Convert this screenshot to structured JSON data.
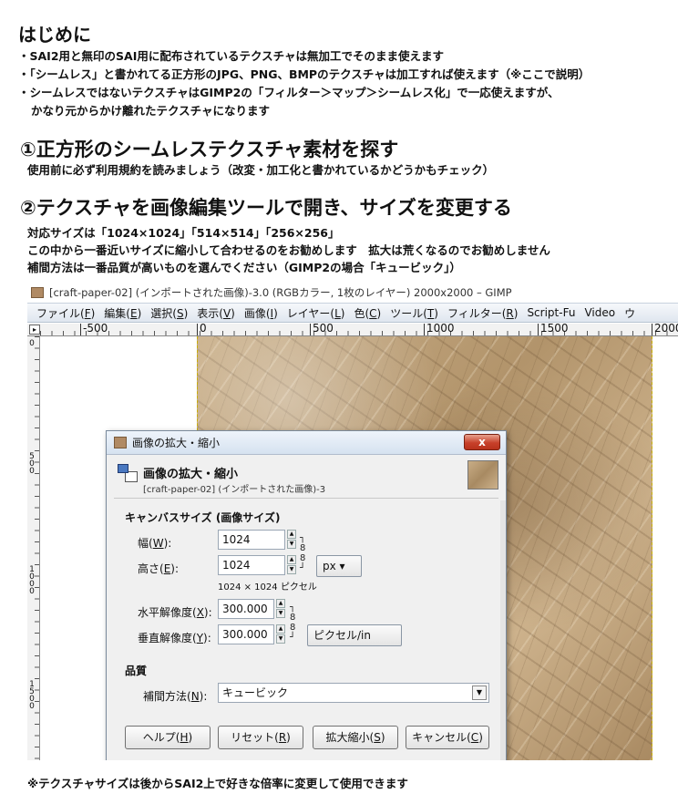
{
  "intro": {
    "title": "はじめに",
    "bullets": [
      "・SAI2用と無印のSAI用に配布されているテクスチャは無加工でそのまま使えます",
      "・「シームレス」と書かれてる正方形のJPG、PNG、BMPのテクスチャは加工すれば使えます（※ここで説明）",
      "・シームレスではないテクスチャはGIMP2の「フィルター＞マップ＞シームレス化」で一応使えますが、",
      "かなり元からかけ離れたテクスチャになります"
    ]
  },
  "step1": {
    "heading": "①正方形のシームレステクスチャ素材を探す",
    "note": "使用前に必ず利用規約を読みましょう（改変・加工化と書かれているかどうかもチェック）"
  },
  "step2": {
    "heading": "②テクスチャを画像編集ツールで開き、サイズを変更する",
    "notes": [
      "対応サイズは「1024×1024」「514×514」「256×256」",
      "この中から一番近いサイズに縮小して合わせるのをお勧めします　拡大は荒くなるのでお勧めしません",
      "補間方法は一番品質が高いものを選んでください（GIMP2の場合「キュービック」）"
    ]
  },
  "gimp": {
    "window_title": "[craft-paper-02] (インポートされた画像)-3.0 (RGBカラー, 1枚のレイヤー) 2000x2000 – GIMP",
    "menus": [
      {
        "label": "ファイル(",
        "key": "F",
        "end": ")"
      },
      {
        "label": "編集(",
        "key": "E",
        "end": ")"
      },
      {
        "label": "選択(",
        "key": "S",
        "end": ")"
      },
      {
        "label": "表示(",
        "key": "V",
        "end": ")"
      },
      {
        "label": "画像(",
        "key": "I",
        "end": ")"
      },
      {
        "label": "レイヤー(",
        "key": "L",
        "end": ")"
      },
      {
        "label": "色(",
        "key": "C",
        "end": ")"
      },
      {
        "label": "ツール(",
        "key": "T",
        "end": ")"
      },
      {
        "label": "フィルター(",
        "key": "R",
        "end": ")"
      },
      {
        "label": "Script-Fu",
        "key": "",
        "end": ""
      },
      {
        "label": "Video",
        "key": "",
        "end": ""
      },
      {
        "label": "ウ",
        "key": "",
        "end": ""
      }
    ],
    "hruler_labels": [
      "-500",
      "0",
      "500",
      "1000",
      "1500",
      "2000"
    ],
    "vruler_labels": [
      "0",
      "500",
      "1000",
      "1500"
    ]
  },
  "dialog": {
    "window_title": "画像の拡大・縮小",
    "close_label": "x",
    "header_title": "画像の拡大・縮小",
    "header_subtitle": "[craft-paper-02] (インポートされた画像)-3",
    "canvas_section": "キャンバスサイズ (画像サイズ)",
    "width_label": "幅(",
    "width_key": "W",
    "width_end": "):",
    "width_value": "1024",
    "height_label": "高さ(",
    "height_key": "E",
    "height_end": "):",
    "height_value": "1024",
    "unit": "px",
    "size_info": "1024 × 1024 ピクセル",
    "xres_label": "水平解像度(",
    "xres_key": "X",
    "xres_end": "):",
    "xres_value": "300.000",
    "yres_label": "垂直解像度(",
    "yres_key": "Y",
    "yres_end": "):",
    "yres_value": "300.000",
    "res_unit": "ピクセル/in",
    "quality_section": "品質",
    "interp_label": "補間方法(",
    "interp_key": "N",
    "interp_end": "):",
    "interp_value": "キュービック",
    "help_label": "ヘルプ(",
    "help_key": "H",
    "help_end": ")",
    "reset_label": "リセット(",
    "reset_key": "R",
    "reset_end": ")",
    "scale_label": "拡大縮小(",
    "scale_key": "S",
    "scale_end": ")",
    "cancel_label": "キャンセル(",
    "cancel_key": "C",
    "cancel_end": ")"
  },
  "footer_note": "※テクスチャサイズは後からSAI2上で好きな倍率に変更して使用できます"
}
